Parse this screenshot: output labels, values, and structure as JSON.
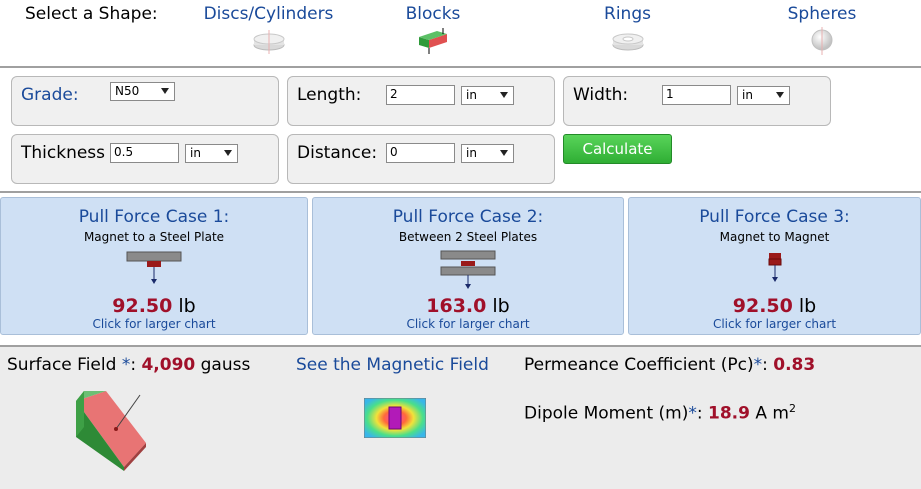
{
  "shape_selector": {
    "title": "Select a Shape:",
    "tabs": [
      {
        "label": "Discs/Cylinders",
        "icon": "disc-icon"
      },
      {
        "label": "Blocks",
        "icon": "block-icon",
        "selected": true
      },
      {
        "label": "Rings",
        "icon": "ring-icon"
      },
      {
        "label": "Spheres",
        "icon": "sphere-icon"
      }
    ]
  },
  "inputs": {
    "grade": {
      "label": "Grade:",
      "value": "N50"
    },
    "length": {
      "label": "Length:",
      "value": "2",
      "unit": "in"
    },
    "width": {
      "label": "Width:",
      "value": "1",
      "unit": "in"
    },
    "thickness": {
      "label": "Thickness",
      "value": "0.5",
      "unit": "in"
    },
    "distance": {
      "label": "Distance:",
      "value": "0",
      "unit": "in"
    },
    "calculate_label": "Calculate"
  },
  "cases": [
    {
      "title": "Pull Force Case 1:",
      "subtitle": "Magnet to a Steel Plate",
      "value": "92.50",
      "unit": "lb",
      "link": "Click for larger chart"
    },
    {
      "title": "Pull Force Case 2:",
      "subtitle": "Between 2 Steel Plates",
      "value": "163.0",
      "unit": "lb",
      "link": "Click for larger chart"
    },
    {
      "title": "Pull Force Case 3:",
      "subtitle": "Magnet to Magnet",
      "value": "92.50",
      "unit": "lb",
      "link": "Click for larger chart"
    }
  ],
  "results": {
    "surface_field_label": "Surface Field ",
    "star": "*",
    "surface_field_value": "4,090",
    "surface_field_unit": "gauss",
    "see_field_link": "See the Magnetic Field",
    "permeance_label": "Permeance Coefficient (Pc)",
    "permeance_value": "0.83",
    "dipole_label": "Dipole Moment (m)",
    "dipole_value": "18.9",
    "dipole_unit": "A m",
    "dipole_exp": "2"
  },
  "colors": {
    "link_blue": "#1a4a9a",
    "value_red": "#a0102a",
    "case_bg": "#cfe0f4",
    "calc_green": "#3cbf40"
  }
}
